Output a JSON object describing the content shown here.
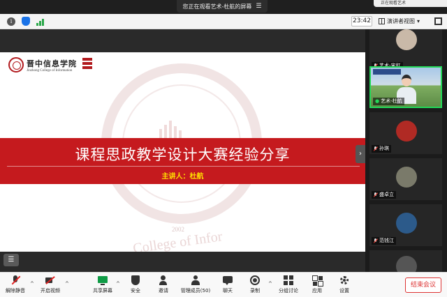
{
  "share_banner": {
    "text": "您正在观看艺术-杜航的屏幕",
    "menu_icon": "menu-icon"
  },
  "corner_tab": {
    "text": "正在观看艺术"
  },
  "topbar": {
    "time": "23:42",
    "view_label": "演讲者视图"
  },
  "slide": {
    "logo_cn": "晋中信息学院",
    "logo_en": "Jinzhong College of Information",
    "title": "课程思政教学设计大赛经验分享",
    "speaker": "主讲人：杜航",
    "watermark_year": "2002",
    "watermark_text": "College of Infor"
  },
  "participants": [
    {
      "name": "艺术-宋虹",
      "muted": true
    },
    {
      "name": "艺术-杜航",
      "muted": false,
      "active": true
    },
    {
      "name": "孙琪",
      "muted": true
    },
    {
      "name": "盛卓立",
      "muted": true
    },
    {
      "name": "范钱江",
      "muted": true
    },
    {
      "name": "",
      "muted": true
    }
  ],
  "toolbar": {
    "mute": "解除静音",
    "video": "开启视频",
    "share": "共享屏幕",
    "security": "安全",
    "invite": "邀请",
    "members": "管理成员(50)",
    "chat": "聊天",
    "record": "录制",
    "breakout": "分组讨论",
    "apps": "应用",
    "settings": "设置",
    "end": "结束会议"
  },
  "colors": {
    "brand_red": "#c51a1e",
    "speaker_yellow": "#ffe100",
    "active_green": "#23d959",
    "share_green": "#0e9b45"
  }
}
